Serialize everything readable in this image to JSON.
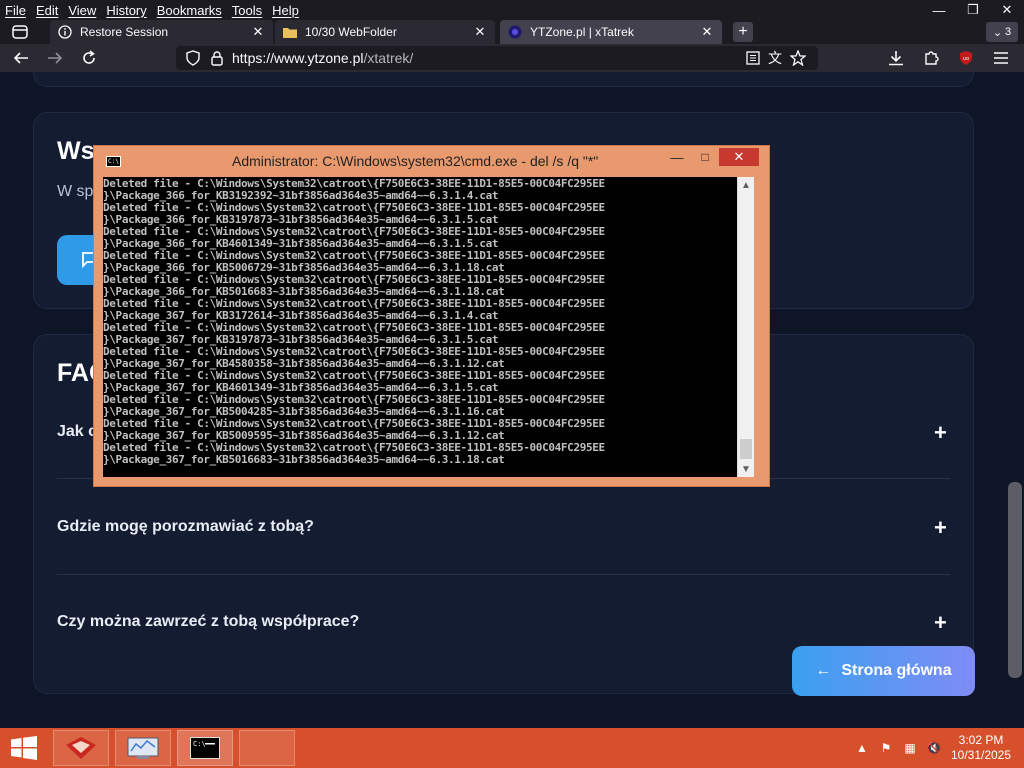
{
  "browser": {
    "menu": [
      "File",
      "Edit",
      "View",
      "History",
      "Bookmarks",
      "Tools",
      "Help"
    ],
    "window_controls": {
      "minimize": "—",
      "restore": "❐",
      "close": "✕"
    },
    "tabs": [
      {
        "title": "Restore Session",
        "icon": "info-icon"
      },
      {
        "title": "10/30 WebFolder",
        "icon": "folder-icon"
      },
      {
        "title": "YTZone.pl | xTatrek",
        "icon": "site-favicon"
      }
    ],
    "tab_close": "✕",
    "new_tab": "+",
    "tab_count": "3",
    "url": {
      "host": "https://www.ytzone.pl",
      "path": "/xtatrek/"
    }
  },
  "page": {
    "partial_heading": "Ws",
    "partial_text": "W sp",
    "faq_heading": "FAQ",
    "faq": [
      {
        "question": "Jak c",
        "toggle": "+"
      },
      {
        "question": "Gdzie mogę porozmawiać z tobą?",
        "toggle": "+"
      },
      {
        "question": "Czy można zawrzeć z tobą współprace?",
        "toggle": "+"
      }
    ],
    "home_button": {
      "arrow": "←",
      "label": "Strona główna"
    }
  },
  "cmd": {
    "title": "Administrator: C:\\Windows\\system32\\cmd.exe - del  /s /q \"*\"",
    "controls": {
      "minimize": "—",
      "maximize": "□",
      "close": "✕"
    },
    "lines": [
      "Deleted file - C:\\Windows\\System32\\catroot\\{F750E6C3-38EE-11D1-85E5-00C04FC295EE",
      "}\\Package_366_for_KB3192392~31bf3856ad364e35~amd64~~6.3.1.4.cat",
      "Deleted file - C:\\Windows\\System32\\catroot\\{F750E6C3-38EE-11D1-85E5-00C04FC295EE",
      "}\\Package_366_for_KB3197873~31bf3856ad364e35~amd64~~6.3.1.5.cat",
      "Deleted file - C:\\Windows\\System32\\catroot\\{F750E6C3-38EE-11D1-85E5-00C04FC295EE",
      "}\\Package_366_for_KB4601349~31bf3856ad364e35~amd64~~6.3.1.5.cat",
      "Deleted file - C:\\Windows\\System32\\catroot\\{F750E6C3-38EE-11D1-85E5-00C04FC295EE",
      "}\\Package_366_for_KB5006729~31bf3856ad364e35~amd64~~6.3.1.18.cat",
      "Deleted file - C:\\Windows\\System32\\catroot\\{F750E6C3-38EE-11D1-85E5-00C04FC295EE",
      "}\\Package_366_for_KB5016683~31bf3856ad364e35~amd64~~6.3.1.18.cat",
      "Deleted file - C:\\Windows\\System32\\catroot\\{F750E6C3-38EE-11D1-85E5-00C04FC295EE",
      "}\\Package_367_for_KB3172614~31bf3856ad364e35~amd64~~6.3.1.4.cat",
      "Deleted file - C:\\Windows\\System32\\catroot\\{F750E6C3-38EE-11D1-85E5-00C04FC295EE",
      "}\\Package_367_for_KB3197873~31bf3856ad364e35~amd64~~6.3.1.5.cat",
      "Deleted file - C:\\Windows\\System32\\catroot\\{F750E6C3-38EE-11D1-85E5-00C04FC295EE",
      "}\\Package_367_for_KB4580358~31bf3856ad364e35~amd64~~6.3.1.12.cat",
      "Deleted file - C:\\Windows\\System32\\catroot\\{F750E6C3-38EE-11D1-85E5-00C04FC295EE",
      "}\\Package_367_for_KB4601349~31bf3856ad364e35~amd64~~6.3.1.5.cat",
      "Deleted file - C:\\Windows\\System32\\catroot\\{F750E6C3-38EE-11D1-85E5-00C04FC295EE",
      "}\\Package_367_for_KB5004285~31bf3856ad364e35~amd64~~6.3.1.16.cat",
      "Deleted file - C:\\Windows\\System32\\catroot\\{F750E6C3-38EE-11D1-85E5-00C04FC295EE",
      "}\\Package_367_for_KB5009595~31bf3856ad364e35~amd64~~6.3.1.12.cat",
      "Deleted file - C:\\Windows\\System32\\catroot\\{F750E6C3-38EE-11D1-85E5-00C04FC295EE",
      "}\\Package_367_for_KB5016683~31bf3856ad364e35~amd64~~6.3.1.18.cat"
    ]
  },
  "taskbar": {
    "clock": {
      "time": "3:02 PM",
      "date": "10/31/2025"
    },
    "tray_icons": [
      "show-hidden-icon",
      "action-center-flag-icon",
      "network-icon",
      "volume-muted-icon"
    ],
    "apps": [
      "app-red-icon",
      "app-monitor-icon",
      "cmd-icon",
      "empty-app-slot"
    ]
  },
  "colors": {
    "page_bg": "#0e1526",
    "card_bg": "#131c30",
    "taskbar": "#d6502b",
    "cmd_frame": "#e89a6e",
    "cmd_close": "#c7392e",
    "accent": "#3aa0f0"
  }
}
